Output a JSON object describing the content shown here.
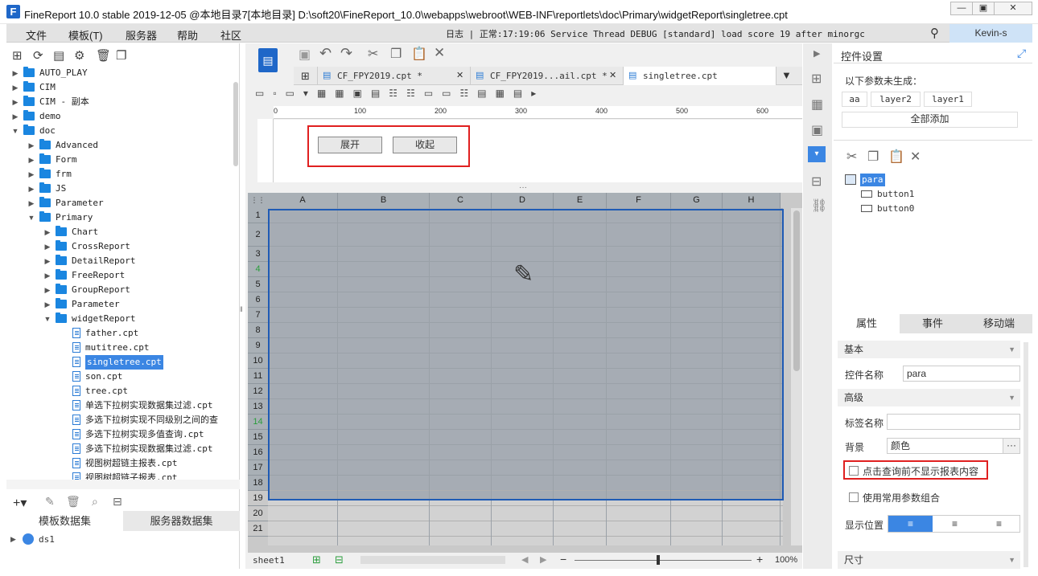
{
  "window": {
    "title": "FineReport 10.0 stable 2019-12-05 @本地目录7[本地目录]    D:\\soft20\\FineReport_10.0\\webapps\\webroot\\WEB-INF\\reportlets\\doc\\Primary\\widgetReport\\singletree.cpt",
    "logo": "F"
  },
  "menubar": {
    "items": [
      "文件",
      "模板(T)",
      "服务器",
      "帮助",
      "社区"
    ],
    "status": "日志 | 正常:17:19:06 Service Thread DEBUG [standard] load score 19 after minorgc",
    "user": "Kevin-s"
  },
  "tree": [
    {
      "label": "AUTO_PLAY",
      "depth": 0,
      "type": "folder",
      "expanded": false
    },
    {
      "label": "CIM",
      "depth": 0,
      "type": "folder",
      "expanded": false
    },
    {
      "label": "CIM - 副本",
      "depth": 0,
      "type": "folder",
      "expanded": false
    },
    {
      "label": "demo",
      "depth": 0,
      "type": "folder",
      "expanded": false
    },
    {
      "label": "doc",
      "depth": 0,
      "type": "folder",
      "expanded": true
    },
    {
      "label": "Advanced",
      "depth": 1,
      "type": "folder",
      "expanded": false
    },
    {
      "label": "Form",
      "depth": 1,
      "type": "folder",
      "expanded": false
    },
    {
      "label": "frm",
      "depth": 1,
      "type": "folder",
      "expanded": false
    },
    {
      "label": "JS",
      "depth": 1,
      "type": "folder",
      "expanded": false
    },
    {
      "label": "Parameter",
      "depth": 1,
      "type": "folder",
      "expanded": false
    },
    {
      "label": "Primary",
      "depth": 1,
      "type": "folder",
      "expanded": true
    },
    {
      "label": "Chart",
      "depth": 2,
      "type": "folder",
      "expanded": false
    },
    {
      "label": "CrossReport",
      "depth": 2,
      "type": "folder",
      "expanded": false
    },
    {
      "label": "DetailReport",
      "depth": 2,
      "type": "folder",
      "expanded": false
    },
    {
      "label": "FreeReport",
      "depth": 2,
      "type": "folder",
      "expanded": false
    },
    {
      "label": "GroupReport",
      "depth": 2,
      "type": "folder",
      "expanded": false
    },
    {
      "label": "Parameter",
      "depth": 2,
      "type": "folder",
      "expanded": false
    },
    {
      "label": "widgetReport",
      "depth": 2,
      "type": "folder",
      "expanded": true
    },
    {
      "label": "father.cpt",
      "depth": 3,
      "type": "file"
    },
    {
      "label": "mutitree.cpt",
      "depth": 3,
      "type": "file"
    },
    {
      "label": "singletree.cpt",
      "depth": 3,
      "type": "file",
      "selected": true
    },
    {
      "label": "son.cpt",
      "depth": 3,
      "type": "file"
    },
    {
      "label": "tree.cpt",
      "depth": 3,
      "type": "file"
    },
    {
      "label": "单选下拉树实现数据集过滤.cpt",
      "depth": 3,
      "type": "file"
    },
    {
      "label": "多选下拉树实现不同级别之间的查",
      "depth": 3,
      "type": "file"
    },
    {
      "label": "多选下拉树实现多值查询.cpt",
      "depth": 3,
      "type": "file"
    },
    {
      "label": "多选下拉树实现数据集过滤.cpt",
      "depth": 3,
      "type": "file"
    },
    {
      "label": "视图树超链主报表.cpt",
      "depth": 3,
      "type": "file"
    },
    {
      "label": "视图树超链子报表.cpt",
      "depth": 3,
      "type": "file"
    }
  ],
  "dataset_tabs": [
    "模板数据集",
    "服务器数据集"
  ],
  "dataset_items": [
    "ds1"
  ],
  "doc_tabs": [
    "CF_FPY2019.cpt *",
    "CF_FPY2019...ail.cpt *",
    "singletree.cpt"
  ],
  "ruler": [
    "0",
    "100",
    "200",
    "300",
    "400",
    "500",
    "600"
  ],
  "form_buttons": [
    "展开",
    "收起"
  ],
  "columns": [
    "A",
    "B",
    "C",
    "D",
    "E",
    "F",
    "G",
    "H"
  ],
  "rows": [
    "1",
    "2",
    "3",
    "4",
    "5",
    "6",
    "7",
    "8",
    "9",
    "10",
    "11",
    "12",
    "13",
    "14",
    "15",
    "16",
    "17",
    "18",
    "19",
    "20",
    "21"
  ],
  "sheet": {
    "tab": "sheet1",
    "zoom": "100%"
  },
  "right": {
    "title": "控件设置",
    "ungenerated_label": "以下参数未生成：",
    "params": [
      "aa",
      "layer2",
      "layer1"
    ],
    "add_all": "全部添加",
    "widget_tree": {
      "root": "para",
      "children": [
        "button1",
        "button0"
      ]
    },
    "tabs": [
      "属性",
      "事件",
      "移动端"
    ],
    "section_basic": "基本",
    "widget_name_label": "控件名称",
    "widget_name_value": "para",
    "section_advanced": "高级",
    "tag_name_label": "标签名称",
    "tag_name_value": "",
    "background_label": "背景",
    "background_value": "颜色",
    "hide_before_query": "点击查询前不显示报表内容",
    "use_param_combo": "使用常用参数组合",
    "display_position_label": "显示位置",
    "section_size": "尺寸"
  },
  "colors": {
    "accent": "#3b86e3",
    "highlight": "#e02020",
    "grid_bg": "#a6acb4",
    "selection": "#1f5bb5"
  }
}
